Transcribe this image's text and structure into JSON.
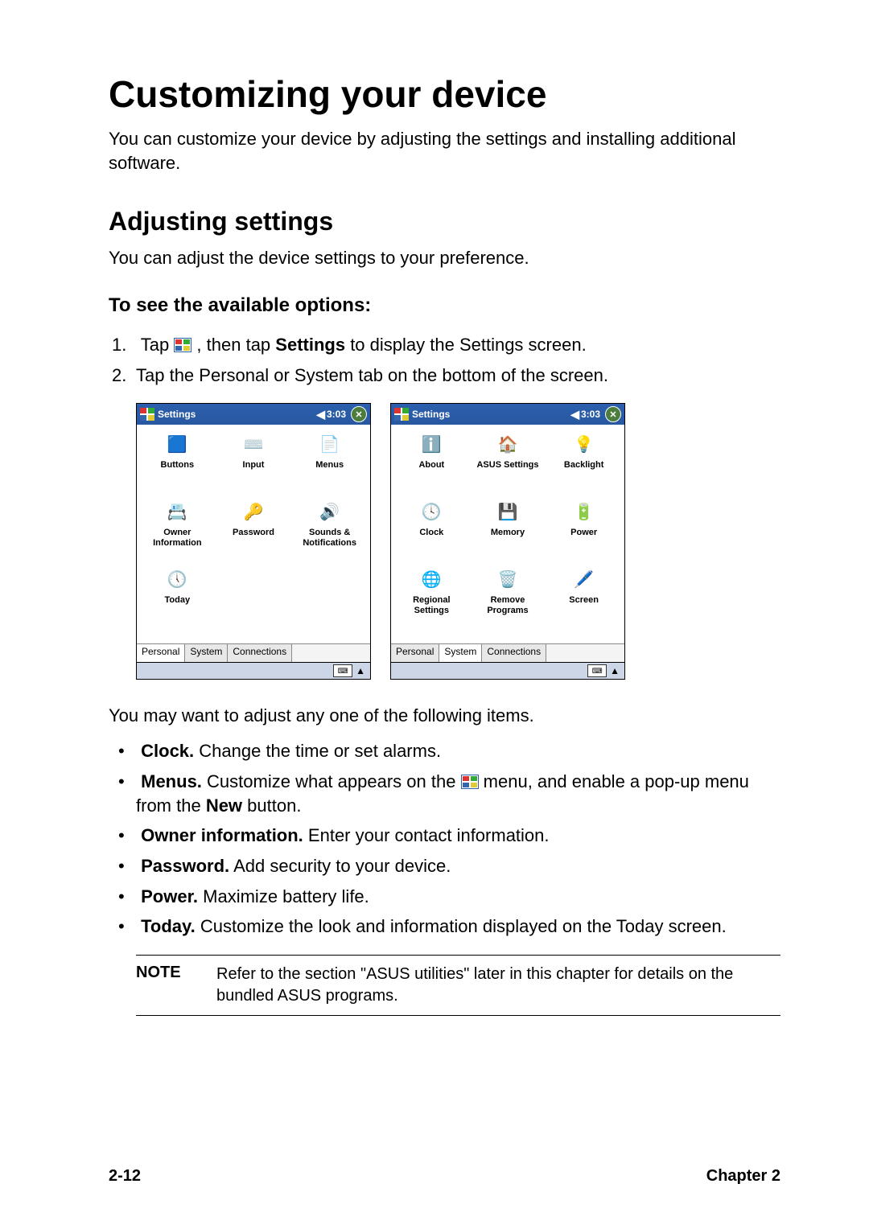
{
  "h1": "Customizing your device",
  "intro": "You can customize your device by adjusting the settings and installing additional software.",
  "h2": "Adjusting settings",
  "sub_intro": "You can adjust the device settings to your preference.",
  "h3": "To see the available options:",
  "step1_pre": "Tap ",
  "step1_mid": " , then tap ",
  "step1_bold": "Settings",
  "step1_post": " to display the Settings screen.",
  "step2": "Tap the Personal or System tab on the bottom of the screen.",
  "pda": {
    "title": "Settings",
    "time": "3:03",
    "tabs": {
      "personal": "Personal",
      "system": "System",
      "connections": "Connections"
    }
  },
  "personal_items": [
    "Buttons",
    "Input",
    "Menus",
    "Owner Information",
    "Password",
    "Sounds & Notifications",
    "Today"
  ],
  "system_items": [
    "About",
    "ASUS Settings",
    "Backlight",
    "Clock",
    "Memory",
    "Power",
    "Regional Settings",
    "Remove Programs",
    "Screen"
  ],
  "para2": "You may want to adjust any one of the following items.",
  "bullets": {
    "clock": {
      "label": "Clock.",
      "text": " Change the time or set alarms."
    },
    "menus": {
      "label": "Menus.",
      "text1": " Customize what appears on the ",
      "text2": " menu, and enable a pop-up menu from the ",
      "bold2": "New",
      "text3": " button."
    },
    "owner": {
      "label": "Owner information.",
      "text": " Enter your contact information."
    },
    "password": {
      "label": "Password.",
      "text": " Add security to your device."
    },
    "power": {
      "label": "Power.",
      "text": " Maximize battery life."
    },
    "today": {
      "label": "Today.",
      "text": " Customize the look and information displayed on the Today screen."
    }
  },
  "note": {
    "label": "NOTE",
    "text": "Refer to the section \"ASUS utilities\" later in this chapter for details on the bundled ASUS programs."
  },
  "footer": {
    "left": "2-12",
    "right": "Chapter 2"
  },
  "icons": {
    "personal": [
      "🟦",
      "⌨️",
      "📄",
      "📇",
      "🔑",
      "🔊",
      "🕔"
    ],
    "system": [
      "ℹ️",
      "🏠",
      "💡",
      "🕓",
      "💾",
      "🔋",
      "🌐",
      "🗑️",
      "🖊️"
    ]
  }
}
